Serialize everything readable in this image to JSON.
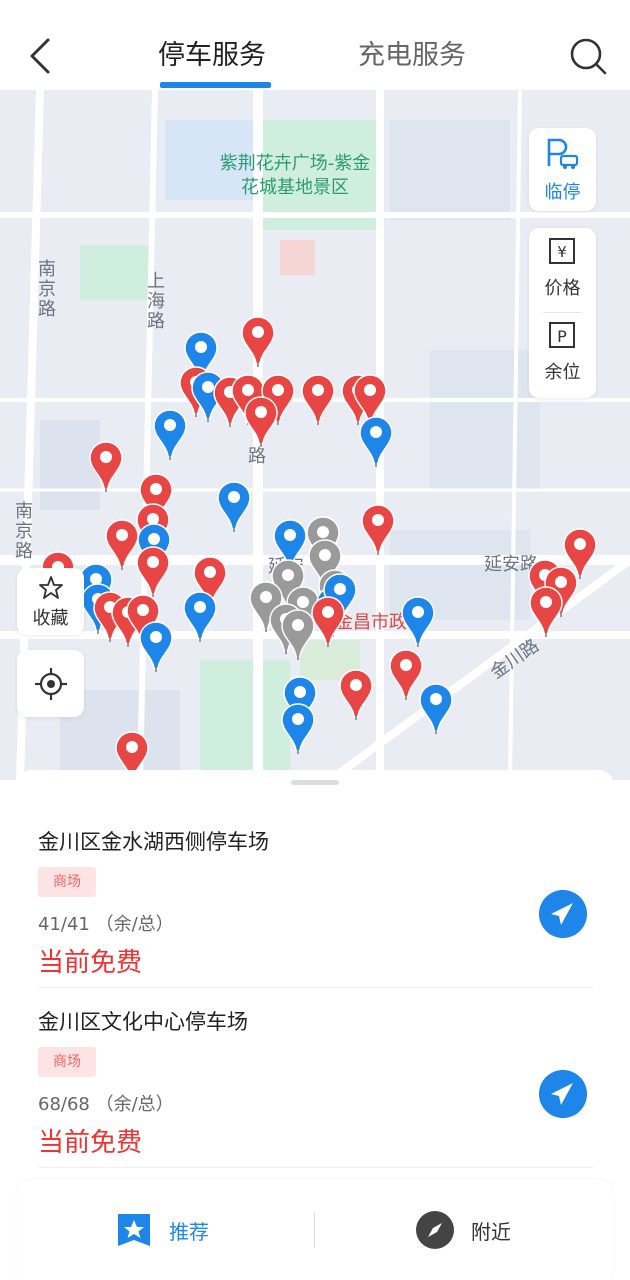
{
  "header": {
    "tab_parking": "停车服务",
    "tab_charging": "充电服务"
  },
  "map": {
    "park_label": "紫荆花卉广场-紫金花城基地景区",
    "road_nanjing_1": "南京路",
    "road_shanghai": "上海路",
    "road_nanjing_2": "南京路",
    "road_yanan": "延安路",
    "road_jinchuan": "金川路",
    "gov_label": "金昌市政",
    "fragment_yan": "延安",
    "fragment_lu": "路"
  },
  "controls": {
    "temp_park": "临停",
    "price": "价格",
    "spaces": "余位",
    "favorite": "收藏"
  },
  "list": [
    {
      "name": "金川区金水湖西侧停车场",
      "tag": "商场",
      "count": "41/41 （余/总）",
      "status": "当前免费"
    },
    {
      "name": "金川区文化中心停车场",
      "tag": "商场",
      "count": "68/68 （余/总）",
      "status": "当前免费"
    }
  ],
  "bottom_nav": {
    "recommend": "推荐",
    "nearby": "附近"
  },
  "colors": {
    "accent": "#1d86e8",
    "pin_red": "#e84545",
    "pin_blue": "#1d86e8",
    "pin_gray": "#9a9a9a",
    "free_text": "#ee3333"
  }
}
